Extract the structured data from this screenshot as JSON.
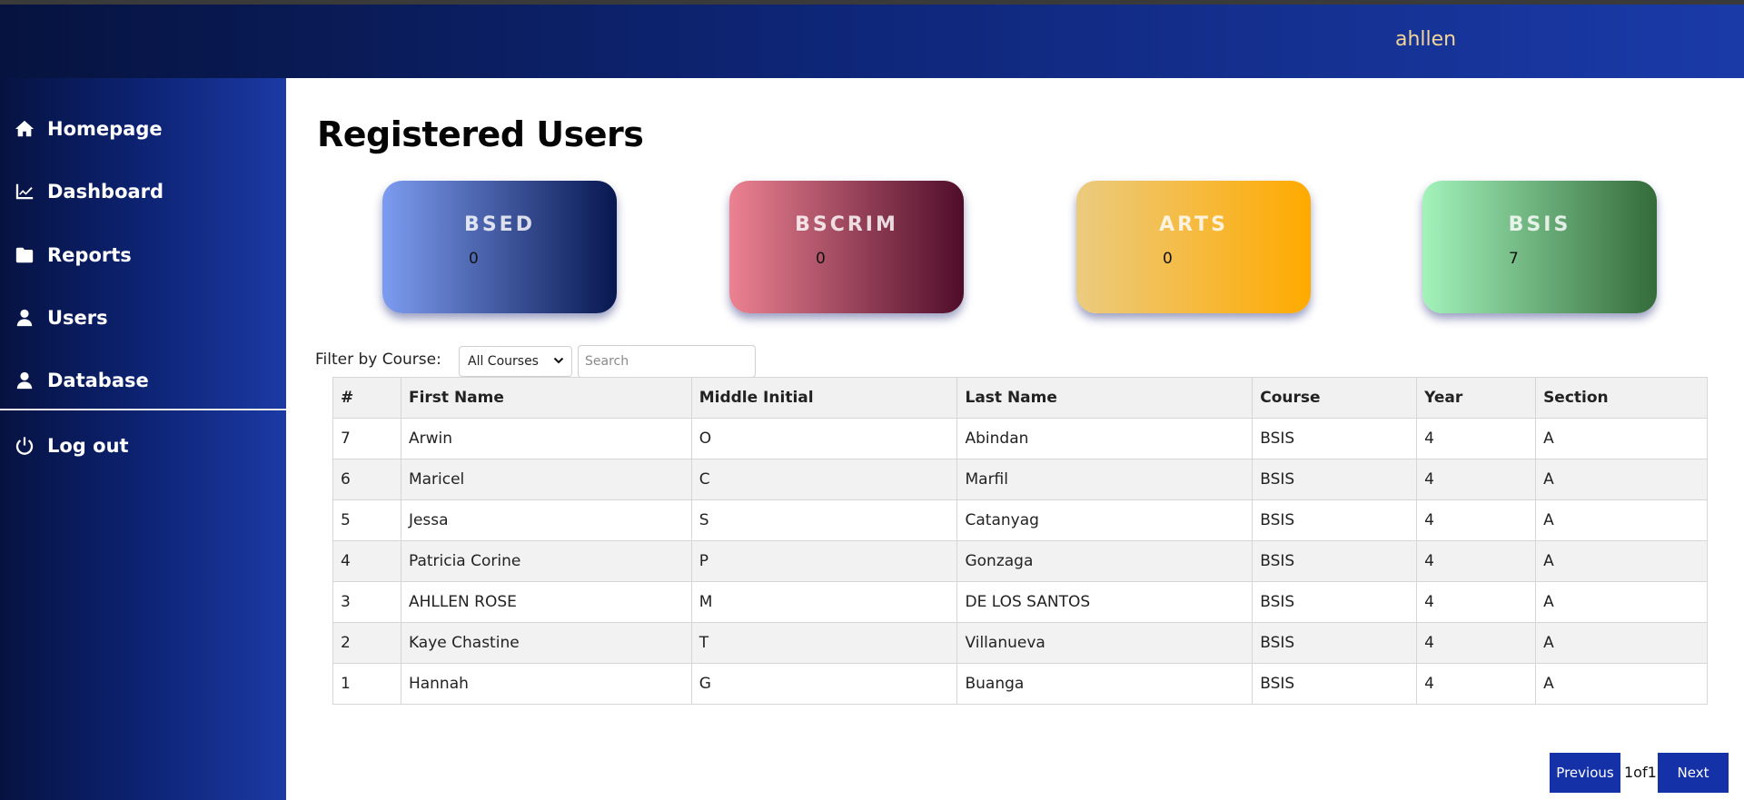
{
  "header": {
    "username": "ahllen"
  },
  "sidebar": {
    "items": [
      {
        "label": "Homepage",
        "icon": "home-icon"
      },
      {
        "label": "Dashboard",
        "icon": "chart-line-icon"
      },
      {
        "label": "Reports",
        "icon": "folder-icon"
      },
      {
        "label": "Users",
        "icon": "user-icon"
      },
      {
        "label": "Database",
        "icon": "user-icon"
      }
    ],
    "logout": {
      "label": "Log out",
      "icon": "power-icon"
    }
  },
  "main": {
    "title": "Registered Users",
    "cards": [
      {
        "name": "BSED",
        "count": "0",
        "gradient": [
          "#7d9cf0",
          "#071750"
        ]
      },
      {
        "name": "BSCRIM",
        "count": "0",
        "gradient": [
          "#ec8292",
          "#4f0d2a"
        ]
      },
      {
        "name": "ARTS",
        "count": "0",
        "gradient": [
          "#ebcb80",
          "#ffaa00"
        ]
      },
      {
        "name": "BSIS",
        "count": "7",
        "gradient": [
          "#a3f3bb",
          "#346b3b"
        ]
      }
    ],
    "filter": {
      "label": "Filter by Course:",
      "selected_course": "All Courses",
      "search_placeholder": "Search"
    },
    "table": {
      "headers": [
        "#",
        "First Name",
        "Middle Initial",
        "Last Name",
        "Course",
        "Year",
        "Section"
      ],
      "rows": [
        [
          "7",
          "Arwin",
          "O",
          "Abindan",
          "BSIS",
          "4",
          "A"
        ],
        [
          "6",
          "Maricel",
          "C",
          "Marfil",
          "BSIS",
          "4",
          "A"
        ],
        [
          "5",
          "Jessa",
          "S",
          "Catanyag",
          "BSIS",
          "4",
          "A"
        ],
        [
          "4",
          "Patricia Corine",
          "P",
          "Gonzaga",
          "BSIS",
          "4",
          "A"
        ],
        [
          "3",
          "AHLLEN ROSE",
          "M",
          "DE LOS SANTOS",
          "BSIS",
          "4",
          "A"
        ],
        [
          "2",
          "Kaye Chastine",
          "T",
          "Villanueva",
          "BSIS",
          "4",
          "A"
        ],
        [
          "1",
          "Hannah",
          "G",
          "Buanga",
          "BSIS",
          "4",
          "A"
        ]
      ]
    },
    "pagination": {
      "previous_label": "Previous",
      "page_info": "1of1",
      "next_label": "Next"
    }
  },
  "colors": {
    "accent": "#1531a8",
    "username": "#f4d497"
  }
}
